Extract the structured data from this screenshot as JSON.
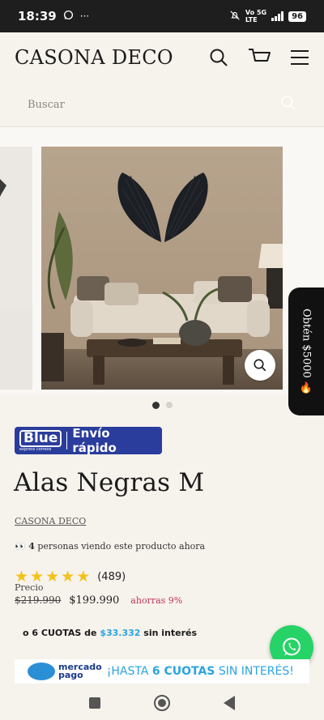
{
  "status_bar": {
    "time": "18:39",
    "icons": [
      "whatsapp-icon",
      "more-icon"
    ],
    "network_top": "Vo 5G",
    "network_bottom": "LTE",
    "battery": "96"
  },
  "header": {
    "brand": "CASONA DECO",
    "icons": [
      "search-icon",
      "cart-icon",
      "menu-icon"
    ]
  },
  "search": {
    "placeholder": "Buscar"
  },
  "gallery": {
    "slides": 2,
    "current": 1
  },
  "promo_tab": {
    "label": "Obtén $5000 🔥"
  },
  "shipping_badge": {
    "brand": "Blue",
    "brand_sub": "express correos",
    "text": "Envío rápido"
  },
  "product": {
    "title": "Alas Negras M",
    "vendor": "CASONA DECO",
    "viewers_emoji": "👀",
    "viewers_count": "4",
    "viewers_text": "personas viendo este producto ahora",
    "rating": 5,
    "rating_count": "(489)",
    "price_label": "Precio",
    "compare_price": "$219.990",
    "price": "$199.990",
    "savings": "ahorras 9%",
    "cuotas_prefix": "o 6 CUOTAS de",
    "cuotas_amount": "$33.332",
    "cuotas_suffix": "sin interés"
  },
  "mercadopago_banner": {
    "logo_top": "mercado",
    "logo_bottom": "pago",
    "text_prefix": "¡HASTA",
    "text_bold": "6 CUOTAS",
    "text_suffix": "SIN INTERÉS!"
  },
  "colors": {
    "background": "#f6f2ec",
    "blue_badge": "#2a3d9c",
    "whatsapp": "#25d366",
    "savings": "#c0335a",
    "star": "#f2c21a",
    "cuotas_amount": "#2aa4e0"
  }
}
